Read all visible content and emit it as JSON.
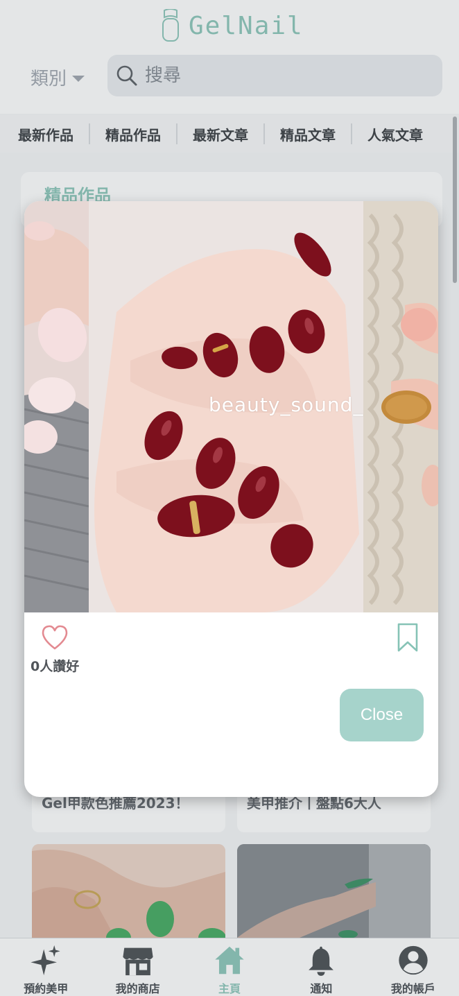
{
  "header": {
    "logo_text": "GelNail",
    "category_label": "類別",
    "search_placeholder": "搜尋"
  },
  "tabs": [
    {
      "label": "最新作品"
    },
    {
      "label": "精品作品"
    },
    {
      "label": "最新文章"
    },
    {
      "label": "精品文章"
    },
    {
      "label": "人氣文章"
    }
  ],
  "section": {
    "title": "精品作品"
  },
  "cards": [
    {
      "title": "Gel甲款色推薦2023！"
    },
    {
      "title": "美甲推介丨盤點6大人"
    }
  ],
  "modal": {
    "watermark": "beauty_sound_",
    "likes_text": "0人讚好",
    "close_label": "Close",
    "liked": false,
    "bookmarked": false
  },
  "bottom_nav": [
    {
      "label": "預約美甲",
      "icon": "sparkles-icon"
    },
    {
      "label": "我的商店",
      "icon": "store-icon"
    },
    {
      "label": "主頁",
      "icon": "home-icon",
      "active": true
    },
    {
      "label": "通知",
      "icon": "bell-icon"
    },
    {
      "label": "我的帳戶",
      "icon": "account-icon"
    }
  ],
  "colors": {
    "brand": "#86c3b6",
    "close_button": "#a6d3cb",
    "heart": "#e38a91",
    "nail_polish": "#7d101d"
  }
}
